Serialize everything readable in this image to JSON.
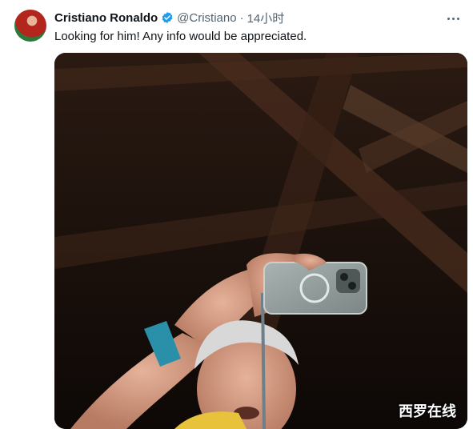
{
  "tweet": {
    "author_name": "Cristiano Ronaldo",
    "handle": "@Cristiano",
    "separator": "·",
    "time": "14小时",
    "text": "Looking for him! Any info would be appreciated."
  },
  "icons": {
    "verified": "verified-badge-icon",
    "more": "more-options-icon"
  },
  "colors": {
    "verified": "#1d9bf0",
    "secondary_text": "#536471"
  },
  "media": {
    "watermark": "西罗在线"
  }
}
